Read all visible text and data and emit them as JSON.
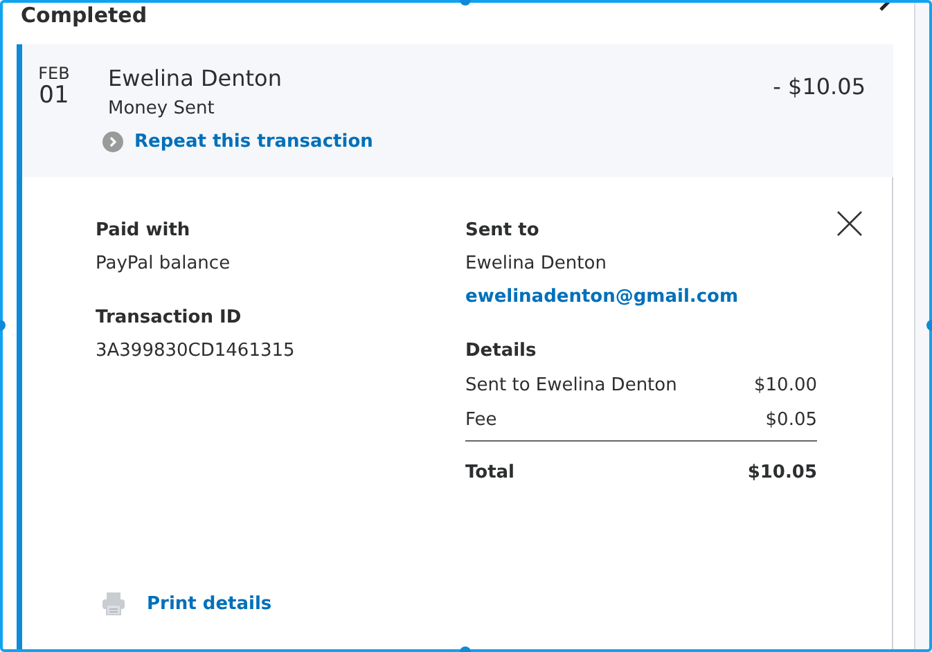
{
  "section_title": "Completed",
  "transaction": {
    "month": "FEB",
    "day": "01",
    "name": "Ewelina Denton",
    "type": "Money Sent",
    "repeat_link": "Repeat this transaction",
    "amount": "- $10.05"
  },
  "details": {
    "paid_with": {
      "label": "Paid with",
      "value": "PayPal balance"
    },
    "transaction_id": {
      "label": "Transaction ID",
      "value": "3A399830CD1461315"
    },
    "sent_to": {
      "label": "Sent to",
      "name": "Ewelina Denton",
      "email": "ewelinadenton@gmail.com"
    },
    "breakdown": {
      "label": "Details",
      "rows": [
        {
          "label": "Sent to Ewelina Denton",
          "amount": "$10.00"
        },
        {
          "label": "Fee",
          "amount": "$0.05"
        }
      ],
      "total": {
        "label": "Total",
        "amount": "$10.05"
      }
    },
    "print_link": "Print details"
  }
}
